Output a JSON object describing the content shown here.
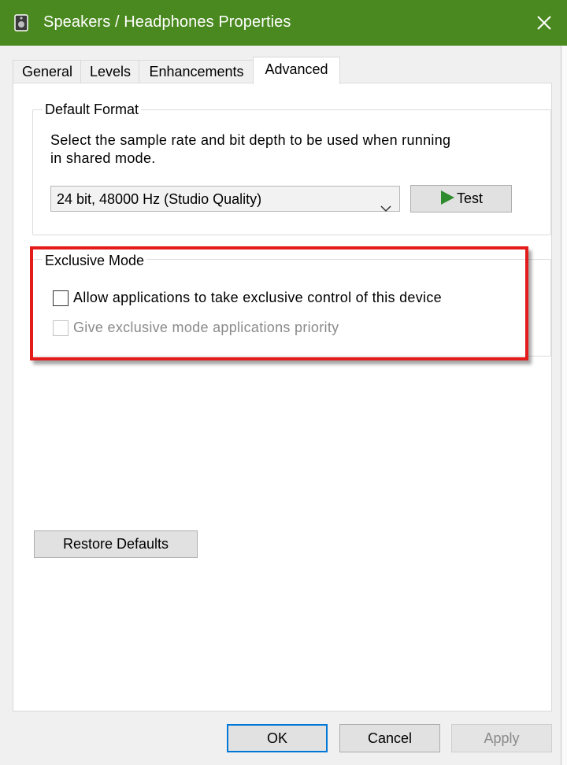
{
  "window": {
    "title": "Speakers / Headphones Properties",
    "icon": "speaker-icon",
    "close_icon": "close-icon",
    "titlebar_color": "#4a891f"
  },
  "tabs": [
    {
      "label": "General",
      "active": false
    },
    {
      "label": "Levels",
      "active": false
    },
    {
      "label": "Enhancements",
      "active": false
    },
    {
      "label": "Advanced",
      "active": true
    }
  ],
  "default_format": {
    "title": "Default Format",
    "description_line1": "Select the sample rate and bit depth to be used when running",
    "description_line2": "in shared mode.",
    "selected_format": "24 bit, 48000 Hz (Studio Quality)",
    "test_label": "Test",
    "test_icon": "play-icon"
  },
  "exclusive_mode": {
    "title": "Exclusive Mode",
    "allow_label": "Allow applications to take exclusive control of this device",
    "allow_checked": false,
    "priority_label": "Give exclusive mode applications priority",
    "priority_checked": false,
    "priority_enabled": false,
    "highlight_color": "#e41b1b"
  },
  "restore_defaults_label": "Restore Defaults",
  "footer": {
    "ok_label": "OK",
    "cancel_label": "Cancel",
    "apply_label": "Apply"
  }
}
